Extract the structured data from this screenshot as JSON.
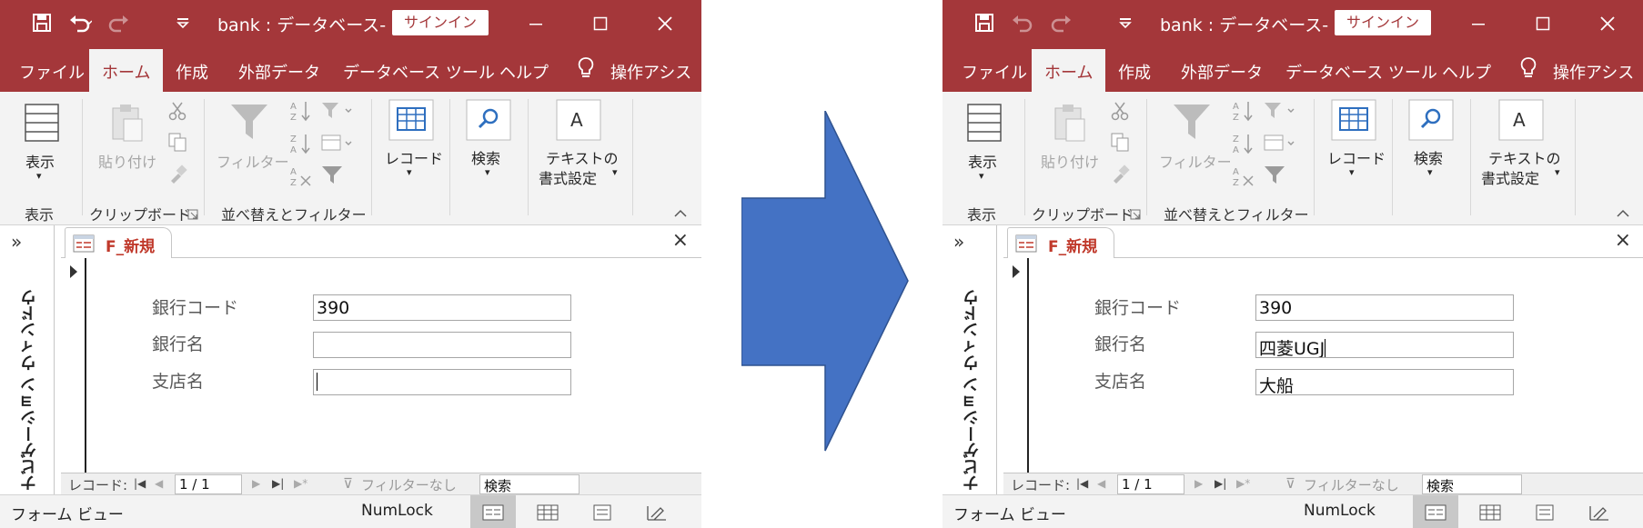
{
  "window": {
    "title": "bank : データベース- ...",
    "signin_label": "サインイン",
    "tabs": [
      "ファイル",
      "ホーム",
      "作成",
      "外部データ",
      "データベース ツール",
      "ヘルプ",
      "操作アシス"
    ],
    "ribbon": {
      "view_btn": "表示",
      "paste_btn": "貼り付け",
      "filter_btn": "フィルター",
      "record_btn": "レコード",
      "find_btn": "検索",
      "text_format_line1": "テキストの",
      "text_format_line2": "書式設定",
      "group_view": "表示",
      "group_clipboard": "クリップボード",
      "group_sort_filter": "並べ替えとフィルター"
    },
    "nav_pane_label": "ナビゲーション ウィンドウ",
    "doc_tab": "F_新規",
    "fields": {
      "bank_code_label": "銀行コード",
      "bank_name_label": "銀行名",
      "branch_name_label": "支店名"
    },
    "record_nav": {
      "label": "レコード:",
      "position": "1 / 1",
      "filter": "フィルターなし",
      "search": "検索"
    },
    "status": {
      "mode": "フォーム ビュー",
      "numlock": "NumLock"
    }
  },
  "before": {
    "bank_code": "390",
    "bank_name": "",
    "branch_name": ""
  },
  "after": {
    "bank_code": "390",
    "bank_name": "四菱UGJ",
    "branch_name": "大船"
  },
  "colors": {
    "accent": "#a4373a",
    "arrow": "#4472c4"
  }
}
